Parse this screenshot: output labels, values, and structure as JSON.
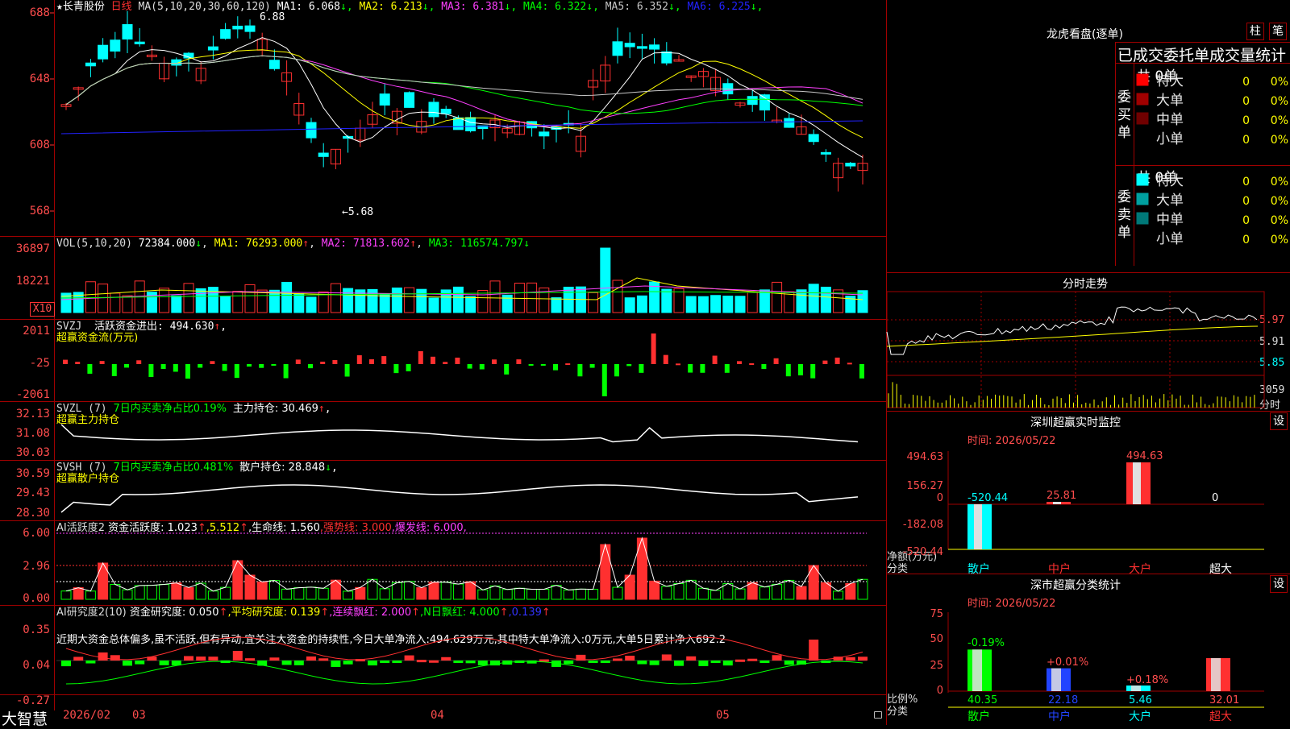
{
  "stock": {
    "star": "★",
    "name": "长青股份",
    "period": "日线"
  },
  "main_panel": {
    "ma_params": "MA(5,10,20,30,60,120)",
    "mas": [
      {
        "label": "MA1:",
        "value": "6.068",
        "arrow": "↓",
        "color": "#ffffff"
      },
      {
        "label": "MA2:",
        "value": "6.213",
        "arrow": "↓",
        "color": "#ffff00"
      },
      {
        "label": "MA3:",
        "value": "6.381",
        "arrow": "↓",
        "color": "#ff40ff"
      },
      {
        "label": "MA4:",
        "value": "6.322",
        "arrow": "↓",
        "color": "#00ff00"
      },
      {
        "label": "MA5:",
        "value": "6.352",
        "arrow": "↓",
        "color": "#c8c8c8"
      },
      {
        "label": "MA6:",
        "value": "6.225",
        "arrow": "↓",
        "color": "#2222ff"
      }
    ],
    "y_labels": [
      "688",
      "648",
      "608",
      "568"
    ],
    "high_mark": "6.88",
    "low_mark": "←5.68"
  },
  "vol_panel": {
    "title": "VOL(5,10,20)",
    "value": "72384.000",
    "arrow": "↓",
    "ma1": "MA1: 76293.000",
    "ma1_arrow": "↑",
    "ma2": "MA2: 71813.602",
    "ma2_arrow": "↑",
    "ma3": "MA3: 116574.797",
    "ma3_arrow": "↓",
    "y_labels": [
      "36897",
      "18221"
    ],
    "unit": "X10"
  },
  "svzj_panel": {
    "title": "SVZJ",
    "line1": "活跃资金进出: 494.630",
    "arrow": "↑",
    "comma": ",",
    "sub": "超赢资金流(万元)",
    "y_labels": [
      "2011",
      "-25",
      "-2061"
    ]
  },
  "svzl_panel": {
    "title": "SVZL (7)",
    "ratio": "7日内买卖净占比0.19%",
    "hold": "主力持仓: 30.469",
    "arrow": "↑",
    "comma": ",",
    "sub": "超赢主力持仓",
    "y_labels": [
      "32.13",
      "31.08",
      "30.03"
    ]
  },
  "svsh_panel": {
    "title": "SVSH (7)",
    "ratio": "7日内买卖净占比0.481%",
    "hold": "散户持仓: 28.848",
    "arrow": "↓",
    "comma": ",",
    "sub": "超赢散户持仓",
    "y_labels": [
      "30.59",
      "29.43",
      "28.30"
    ]
  },
  "ai_active_panel": {
    "title": "AI活跃度2",
    "activity": "资金活跃度: 1.023",
    "a1": "↑",
    "v2": ",5.512",
    "a2": "↑",
    "life": ",生命线: 1.560",
    "strong": ",强势线: 3.000",
    "burst": ",爆发线: 6.000",
    "end": ",",
    "y_labels": [
      "6.00",
      "2.96",
      "0.00"
    ]
  },
  "ai_research_panel": {
    "title": "AI研究度2(10)",
    "research": "资金研究度: 0.050",
    "a1": "↑",
    "avg": ",平均研究度: 0.139",
    "a2": "↑",
    "streak": ",连续飘红: 2.000",
    "a3": "↑",
    "nday": ",N日飘红: 4.000",
    "a4": "↑",
    "last": ",0.139",
    "a5": "↑",
    "desc": "近期大资金总体偏多,虽不活跃,但有异动,宜关注大资金的持续性,今日大单净流入:494.629万元,其中特大单净流入:0万元,大单5日累计净入692.2",
    "y_labels": [
      "0.35",
      "0.04",
      "-0.27"
    ]
  },
  "bottom_bar": {
    "brand": "大智慧",
    "dates": [
      "2026/02",
      "03",
      "04",
      "05"
    ]
  },
  "dragon": {
    "title": "龙虎看盘(逐单)",
    "btn_zhu": "柱",
    "btn_bi": "笔",
    "header": "已成交委托单成交量统计",
    "buy_label": "委买单",
    "sell_label": "委卖单",
    "buy_total": "共 0单",
    "sell_total": "共 0单",
    "buy_rows": [
      {
        "name": "特大",
        "v": "0",
        "p": "0%",
        "color": "#ff0000"
      },
      {
        "name": "大单",
        "v": "0",
        "p": "0%",
        "color": "#a00000"
      },
      {
        "name": "中单",
        "v": "0",
        "p": "0%",
        "color": "#700000"
      },
      {
        "name": "小单",
        "v": "0",
        "p": "0%",
        "color": "#000000"
      }
    ],
    "sell_rows": [
      {
        "name": "特大",
        "v": "0",
        "p": "0%",
        "color": "#00ffff"
      },
      {
        "name": "大单",
        "v": "0",
        "p": "0%",
        "color": "#00a0a0"
      },
      {
        "name": "中单",
        "v": "0",
        "p": "0%",
        "color": "#007878"
      },
      {
        "name": "小单",
        "v": "0",
        "p": "0%",
        "color": "#000000"
      }
    ]
  },
  "intraday": {
    "title": "分时走势",
    "prices": [
      "5.97",
      "5.91",
      "5.85"
    ],
    "vol_top": "3059",
    "vol_label": "分时"
  },
  "monitor": {
    "title": "深圳超赢实时监控",
    "btn": "设",
    "time": "时间: 2026/05/22",
    "y_labels": [
      "494.63",
      "156.27",
      "0",
      "-182.08",
      "-520.44"
    ],
    "axis_label": "净额(万元)",
    "axis_label2": "分类",
    "categories": [
      "散户",
      "中户",
      "大户",
      "超大"
    ],
    "values": [
      "-520.44",
      "25.81",
      "494.63",
      "0"
    ]
  },
  "classify": {
    "title": "深市超赢分类统计",
    "btn": "设",
    "time": "时间: 2026/05/22",
    "y_labels": [
      "75",
      "50",
      "25",
      "0"
    ],
    "axis_label": "比例%",
    "axis_label2": "分类",
    "categories": [
      "散户",
      "中户",
      "大户",
      "超大"
    ],
    "values": [
      "40.35",
      "22.18",
      "5.46",
      "32.01"
    ],
    "changes": [
      "-0.19%",
      "+0.01%",
      "+0.18%",
      ""
    ]
  }
}
